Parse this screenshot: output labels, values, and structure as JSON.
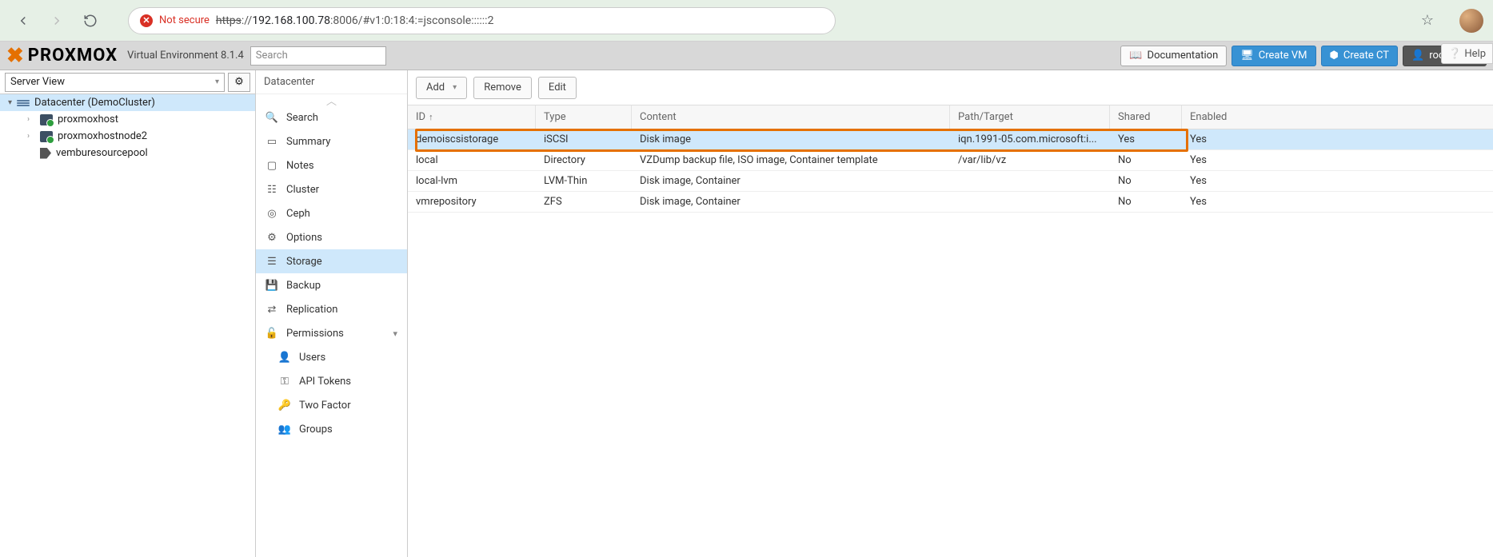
{
  "browser": {
    "not_secure": "Not secure",
    "url_https": "https",
    "url_rest": "://",
    "url_host": "192.168.100.78",
    "url_tail": ":8006/#v1:0:18:4:=jsconsole::::::2"
  },
  "brand": {
    "name": "PROXMOX",
    "env": "Virtual Environment 8.1.4"
  },
  "search": {
    "placeholder": "Search"
  },
  "top_buttons": {
    "doc": "Documentation",
    "create_vm": "Create VM",
    "create_ct": "Create CT",
    "user": "root@pam"
  },
  "tree": {
    "view": "Server View",
    "datacenter": "Datacenter (DemoCluster)",
    "nodes": [
      "proxmoxhost",
      "proxmoxhostnode2"
    ],
    "pool": "vemburesourcepool"
  },
  "nav": {
    "title": "Datacenter",
    "items": {
      "search": "Search",
      "summary": "Summary",
      "notes": "Notes",
      "cluster": "Cluster",
      "ceph": "Ceph",
      "options": "Options",
      "storage": "Storage",
      "backup": "Backup",
      "replication": "Replication",
      "permissions": "Permissions",
      "users": "Users",
      "api_tokens": "API Tokens",
      "two_factor": "Two Factor",
      "groups": "Groups"
    }
  },
  "toolbar": {
    "add": "Add",
    "remove": "Remove",
    "edit": "Edit"
  },
  "columns": {
    "id": "ID",
    "type": "Type",
    "content": "Content",
    "path": "Path/Target",
    "shared": "Shared",
    "enabled": "Enabled"
  },
  "rows": [
    {
      "id": "demoiscsistorage",
      "type": "iSCSI",
      "content": "Disk image",
      "path": "iqn.1991-05.com.microsoft:i...",
      "shared": "Yes",
      "enabled": "Yes"
    },
    {
      "id": "local",
      "type": "Directory",
      "content": "VZDump backup file, ISO image, Container template",
      "path": "/var/lib/vz",
      "shared": "No",
      "enabled": "Yes"
    },
    {
      "id": "local-lvm",
      "type": "LVM-Thin",
      "content": "Disk image, Container",
      "path": "",
      "shared": "No",
      "enabled": "Yes"
    },
    {
      "id": "vmrepository",
      "type": "ZFS",
      "content": "Disk image, Container",
      "path": "",
      "shared": "No",
      "enabled": "Yes"
    }
  ],
  "help": "Help"
}
